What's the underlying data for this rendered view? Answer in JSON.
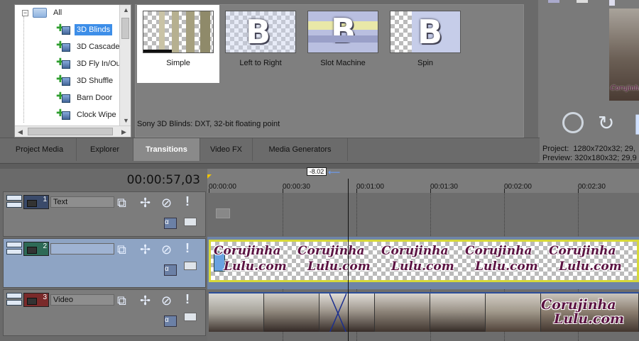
{
  "tree": {
    "root_label": "All",
    "items": [
      "3D Blinds",
      "3D Cascade",
      "3D Fly In/Ou",
      "3D Shuffle",
      "Barn Door",
      "Clock Wipe"
    ],
    "selected": "3D Blinds"
  },
  "transitions": {
    "presets": [
      {
        "label": "Simple",
        "selected": true
      },
      {
        "label": "Left to Right",
        "selected": false
      },
      {
        "label": "Slot Machine",
        "selected": false
      },
      {
        "label": "Spin",
        "selected": false
      }
    ],
    "status": "Sony 3D Blinds: DXT, 32-bit floating point"
  },
  "tabs": [
    "Project Media",
    "Explorer",
    "Transitions",
    "Video FX",
    "Media Generators"
  ],
  "active_tab": "Transitions",
  "preview": {
    "project_label": "Project:",
    "project_value": "1280x720x32; 29,",
    "preview_label": "Preview:",
    "preview_value": "320x180x32; 29,9"
  },
  "timeline": {
    "timecode": "00:00:57,03",
    "marker_value": "-8.02",
    "ruler": [
      "00:00:00",
      "00:00:30",
      "00:01:00",
      "00:01:30",
      "00:02:00",
      "00:02:30"
    ]
  },
  "tracks": [
    {
      "number": "1",
      "name": "Text",
      "color": "#3a4a6a"
    },
    {
      "number": "2",
      "name": "",
      "color": "#2e6a56"
    },
    {
      "number": "3",
      "name": "Video",
      "color": "#7a2a2a"
    }
  ],
  "watermark": {
    "line1": "Corujinha",
    "line2": "Lulu.com"
  }
}
